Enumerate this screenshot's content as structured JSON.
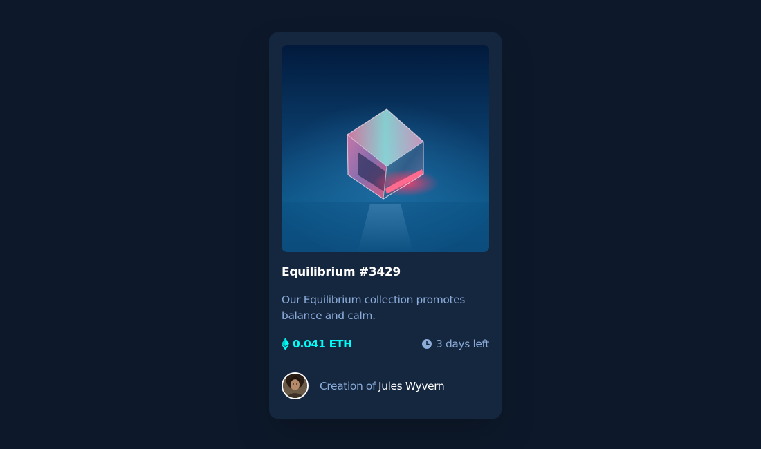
{
  "card": {
    "title": "Equilibrium #3429",
    "description": "Our Equilibrium collection promotes balance and calm.",
    "price": "0.041 ETH",
    "time_left": "3 days left",
    "creator_prefix": "Creation of",
    "creator_name": "Jules Wyvern",
    "image_subject": "glass-cube-image",
    "icons": {
      "price": "ethereum-icon",
      "time": "clock-icon"
    }
  },
  "colors": {
    "page_background": "#0d192b",
    "card_background": "#15263f",
    "accent_cyan": "#00fff8",
    "soft_blue": "#8bacd9",
    "white": "#ffffff",
    "divider": "#2e405a"
  }
}
